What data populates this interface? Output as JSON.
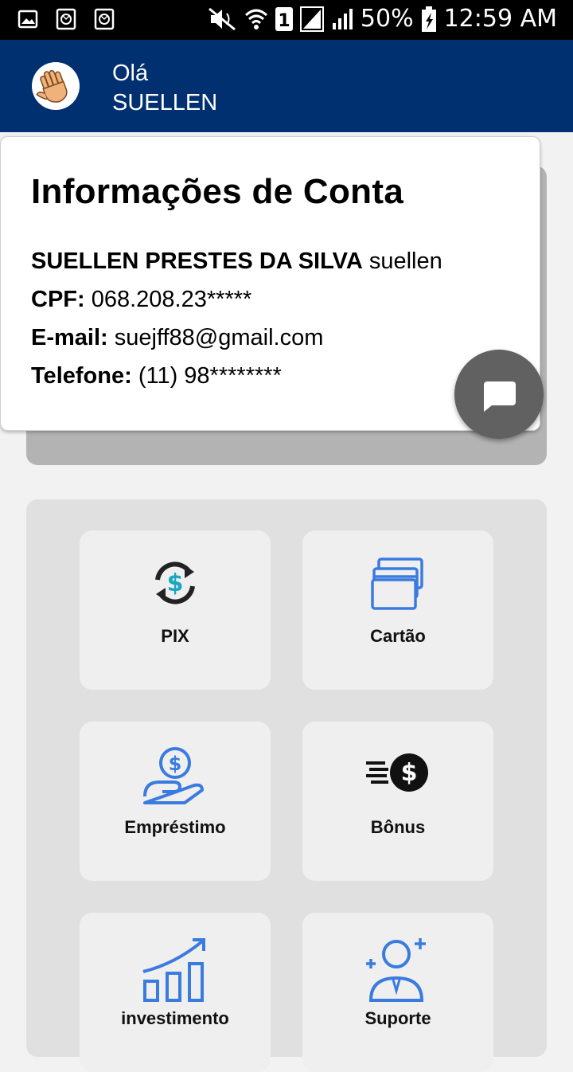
{
  "status_bar": {
    "battery": "50%",
    "time": "12:59 AM",
    "sim_slot": "1",
    "icons": [
      "image-icon",
      "cat-icon",
      "cat-icon",
      "mute-icon",
      "wifi-icon",
      "signal-icon",
      "signal-icon",
      "battery-icon"
    ]
  },
  "header": {
    "greeting": "Olá",
    "username": "SUELLEN",
    "avatar_icon": "waving-hand-icon",
    "color": "#003070"
  },
  "account": {
    "title": "Informações de Conta",
    "full_name": "SUELLEN PRESTES DA SILVA",
    "login": "suellen",
    "cpf_label": "CPF:",
    "cpf": "068.208.23*****",
    "email_label": "E-mail:",
    "email": "suejff88@gmail.com",
    "phone_label": "Telefone:",
    "phone": "(11) 98********"
  },
  "fab": {
    "icon": "chat-icon",
    "color": "#616161"
  },
  "menu": [
    {
      "label": "PIX",
      "icon": "pix-exchange-icon"
    },
    {
      "label": "Cartão",
      "icon": "cards-icon"
    },
    {
      "label": "Empréstimo",
      "icon": "loan-hand-icon"
    },
    {
      "label": "Bônus",
      "icon": "fast-money-icon"
    },
    {
      "label": "investimento",
      "icon": "growth-chart-icon"
    },
    {
      "label": "Suporte",
      "icon": "support-agent-icon"
    }
  ],
  "accent": "#3a7be0"
}
